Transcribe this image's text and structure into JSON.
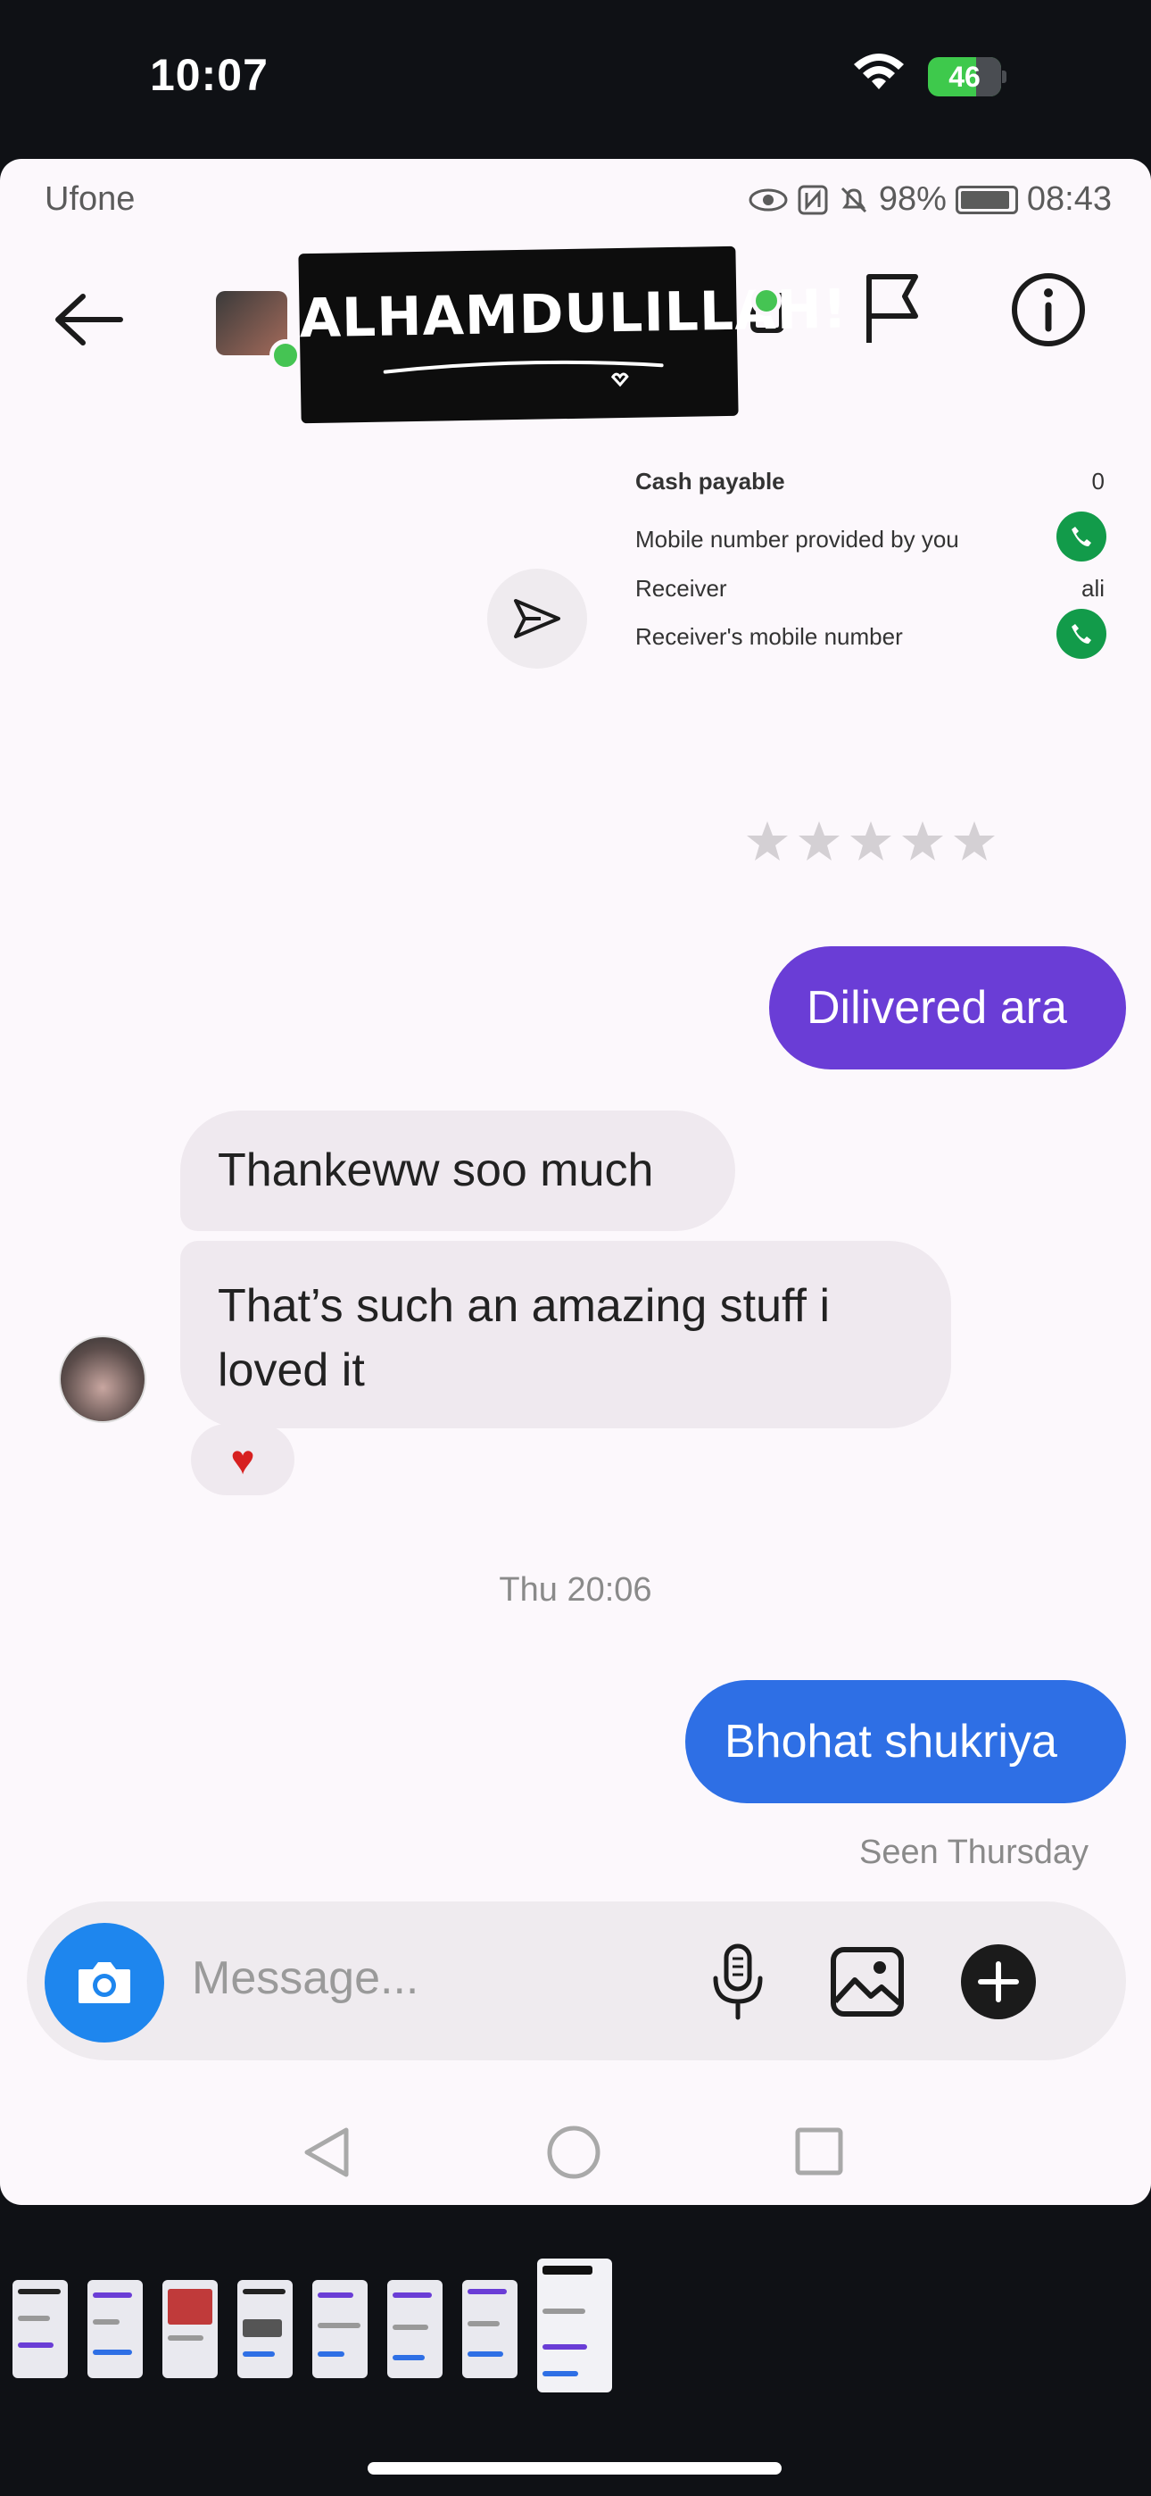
{
  "ios_status": {
    "time": "10:07",
    "battery": "46"
  },
  "android_status": {
    "carrier": "Ufone",
    "battery": "98%",
    "time": "08:43"
  },
  "header": {
    "sticker_text": "ALHAMDULILLAH!"
  },
  "receipt": {
    "rows": [
      {
        "label": "Cash payable",
        "value": "0"
      },
      {
        "label": "Mobile number provided by you",
        "value": ""
      },
      {
        "label": "Receiver",
        "value": "ali"
      },
      {
        "label": "Receiver's mobile number",
        "value": ""
      }
    ]
  },
  "messages": {
    "out1": "Dilivered ara",
    "in1": "Thankeww soo much",
    "in2": "That’s such an amazing stuff i loved it",
    "reaction": "♥",
    "timestamp": "Thu 20:06",
    "out2": "Bhohat shukriya",
    "seen": "Seen Thursday"
  },
  "composer": {
    "placeholder": "Message..."
  },
  "colors": {
    "outgoing_purple": "#6a3dd6",
    "outgoing_blue": "#2e6fe5",
    "camera_blue": "#1e86ee",
    "online_green": "#45c453"
  },
  "icons": [
    "back-arrow-icon",
    "flag-icon",
    "info-icon",
    "send-icon",
    "phone-icon",
    "star-icon",
    "camera-icon",
    "mic-icon",
    "gallery-icon",
    "plus-icon",
    "nav-back-icon",
    "nav-home-icon",
    "nav-recents-icon"
  ]
}
